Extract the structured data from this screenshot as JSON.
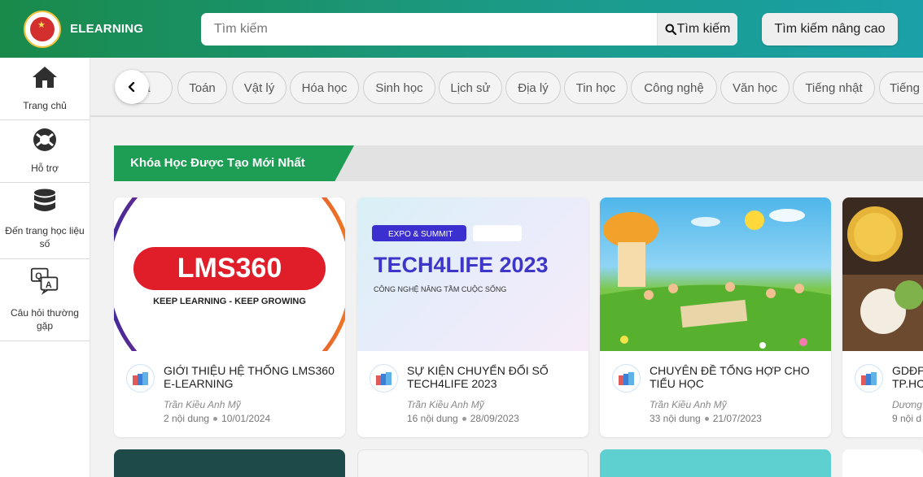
{
  "header": {
    "brand": "ELEARNING",
    "search_placeholder": "Tìm kiếm",
    "search_button": "Tìm kiếm",
    "advanced_button": "Tìm kiếm nâng cao",
    "accent": "#1a8a4a"
  },
  "sidebar": {
    "items": [
      {
        "label": "Trang chủ",
        "icon": "home-icon"
      },
      {
        "label": "Hỗ trợ",
        "icon": "lifebuoy-icon"
      },
      {
        "label": "Đến trang học liệu số",
        "icon": "database-icon"
      },
      {
        "label": "Câu hỏi thường gặp",
        "icon": "qa-icon"
      }
    ]
  },
  "categories": [
    "cả",
    "Toán",
    "Vật lý",
    "Hóa học",
    "Sinh học",
    "Lịch sử",
    "Địa lý",
    "Tin học",
    "Công nghệ",
    "Văn học",
    "Tiếng nhật",
    "Tiếng"
  ],
  "section": {
    "title": "Khóa Học Được Tạo Mới Nhất",
    "color": "#1e9e55"
  },
  "courses": [
    {
      "title": "GIỚI THIỆU HỆ THỐNG LMS360 E-LEARNING",
      "author": "Trần Kiều Anh Mỹ",
      "content_count": "2 nội dung",
      "date": "10/01/2024",
      "thumb": {
        "logo": "LMS360",
        "tagline": "KEEP LEARNING - KEEP GROWING"
      }
    },
    {
      "title": "SỰ KIỆN CHUYỂN ĐỔI SỐ TECH4LIFE 2023",
      "author": "Trần Kiều Anh Mỹ",
      "content_count": "16 nội dung",
      "date": "28/09/2023",
      "thumb": {
        "badge": "EXPO & SUMMIT",
        "headline": "TECH4LIFE 2023",
        "subline": "CÔNG NGHỆ NÂNG TẦM CUỘC SỐNG"
      }
    },
    {
      "title": "CHUYÊN ĐỀ TỔNG HỢP CHO TIỂU HỌC",
      "author": "Trần Kiều Anh Mỹ",
      "content_count": "33 nội dung",
      "date": "21/07/2023",
      "thumb": {}
    },
    {
      "title": "GDĐP TP.HC",
      "author": "Dương",
      "content_count": "9 nội d",
      "date": "",
      "thumb": {}
    }
  ]
}
